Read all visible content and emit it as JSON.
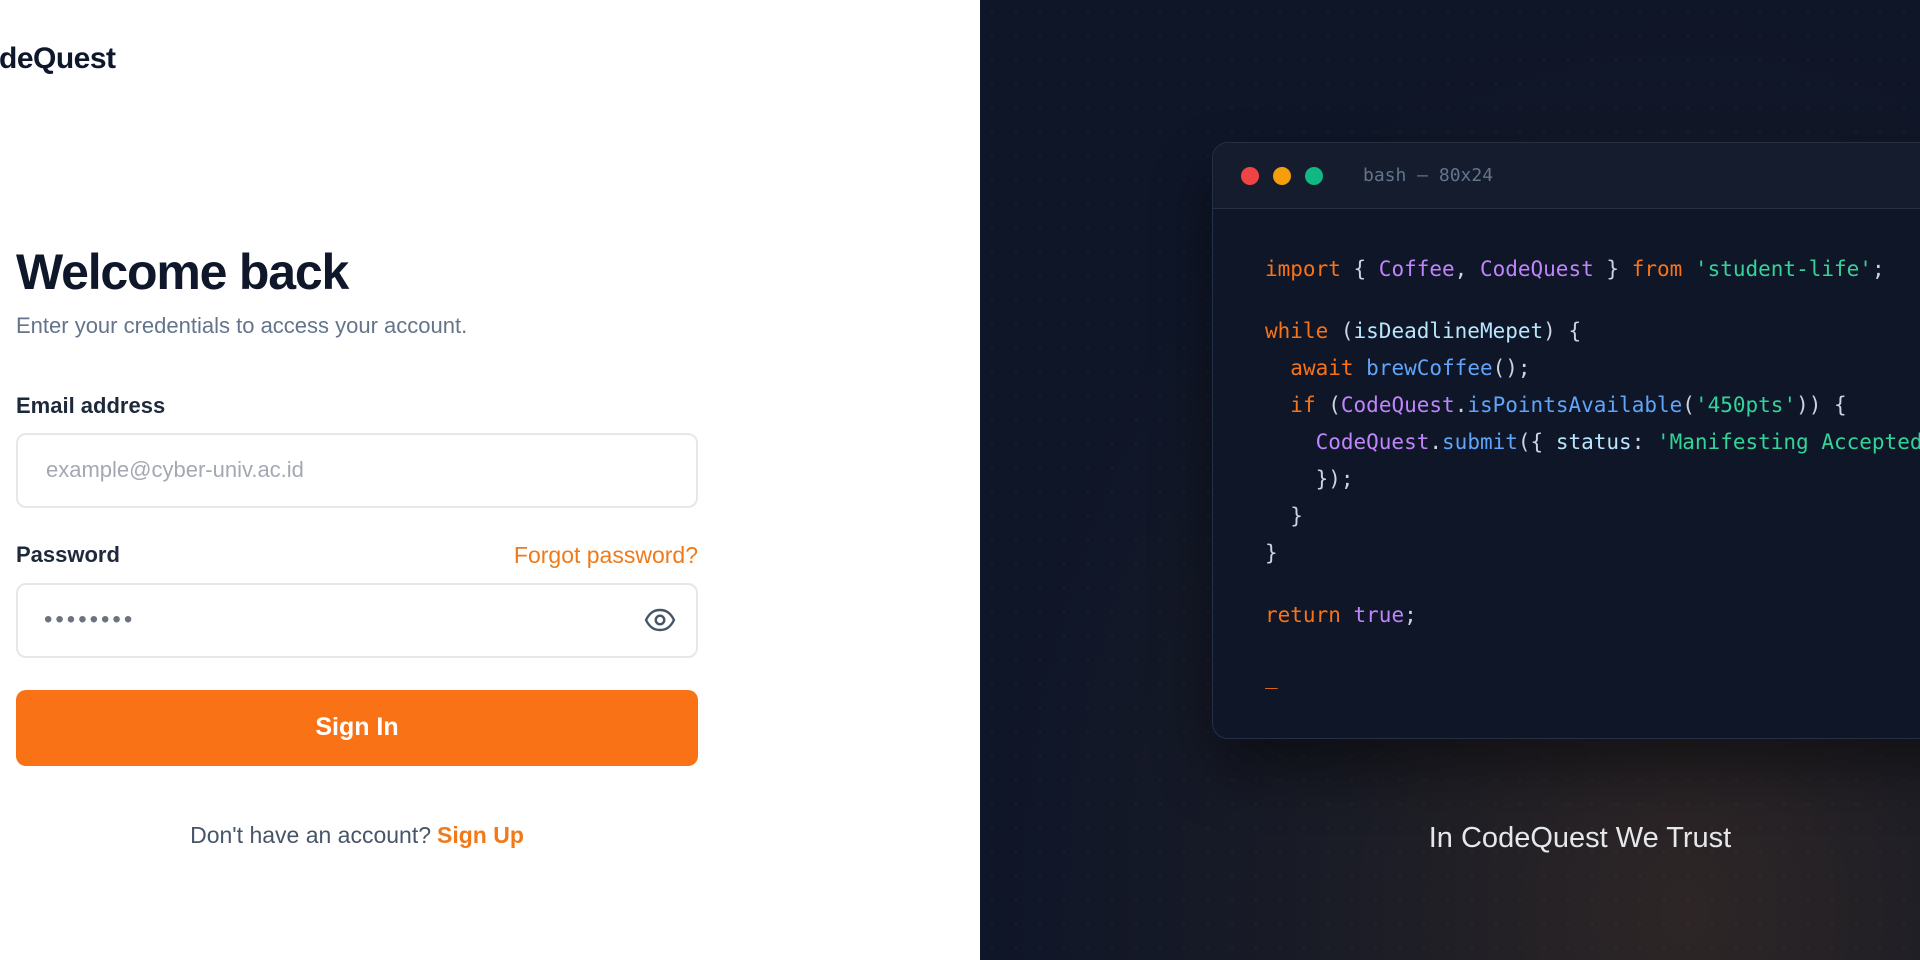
{
  "brand": {
    "name": "CodeQuest"
  },
  "login": {
    "title": "Welcome back",
    "subtitle": "Enter your credentials to access your account.",
    "email_label": "Email address",
    "email_placeholder": "example@cyber-univ.ac.id",
    "password_label": "Password",
    "password_value": "••••••••",
    "forgot_label": "Forgot password?",
    "signin_label": "Sign In",
    "signup_prompt": "Don't have an account?",
    "signup_label": "Sign Up"
  },
  "terminal": {
    "title": "bash — 80x24",
    "code": {
      "line1": {
        "kw1": "import",
        "p1": " { ",
        "c1": "Coffee",
        "p2": ", ",
        "c2": "CodeQuest",
        "p3": " } ",
        "kw2": "from",
        "p4": " ",
        "str": "'student-life'",
        "p5": ";"
      },
      "line2": {
        "kw": "while",
        "p1": " (",
        "v": "isDeadlineMepet",
        "p2": ") {"
      },
      "line3": {
        "ind": "  ",
        "kw": "await",
        "p1": " ",
        "fn": "brewCoffee",
        "p2": "();"
      },
      "line4": {
        "ind": "  ",
        "kw": "if",
        "p1": " (",
        "cls": "CodeQuest",
        "p2": ".",
        "fn": "isPointsAvailable",
        "p3": "(",
        "str": "'450pts'",
        "p4": ")) {"
      },
      "line5": {
        "ind": "    ",
        "cls": "CodeQuest",
        "p1": ".",
        "fn": "submit",
        "p2": "({ ",
        "v": "status",
        "p3": ": ",
        "str": "'Manifesting Accepted'"
      },
      "line6": {
        "text": "    });"
      },
      "line7": {
        "text": "  }"
      },
      "line8": {
        "text": "}"
      },
      "line9": {
        "kw": "return",
        "p1": " ",
        "cls": "true",
        "p2": ";"
      },
      "cursor": "_"
    }
  },
  "tagline": "In CodeQuest We Trust",
  "colors": {
    "accent": "#f97316",
    "panel_dark": "#0f1628"
  }
}
